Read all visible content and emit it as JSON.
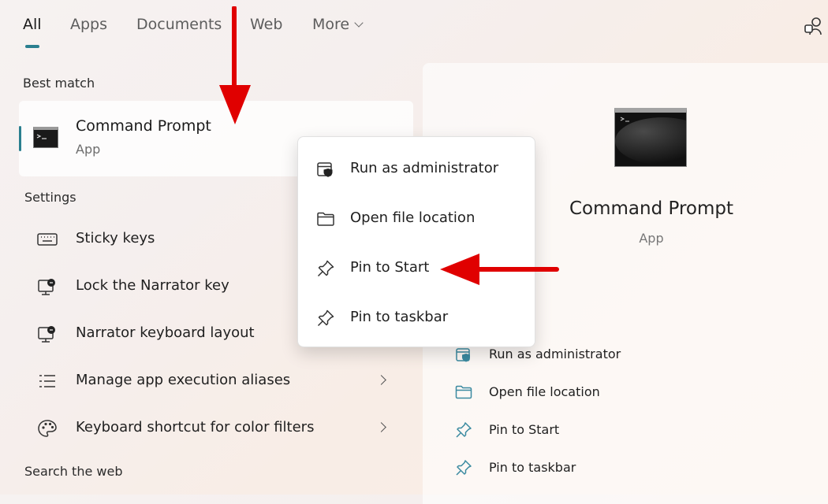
{
  "tabs": [
    {
      "label": "All",
      "active": true
    },
    {
      "label": "Apps",
      "active": false
    },
    {
      "label": "Documents",
      "active": false
    },
    {
      "label": "Web",
      "active": false
    },
    {
      "label": "More",
      "active": false
    }
  ],
  "sections": {
    "best_match": "Best match",
    "settings": "Settings",
    "search_web": "Search the web"
  },
  "best_match": {
    "title": "Command Prompt",
    "subtitle": "App"
  },
  "settings_items": [
    {
      "label": "Sticky keys",
      "icon": "keyboard-icon",
      "has_chevron": false
    },
    {
      "label": "Lock the Narrator key",
      "icon": "narrator-icon",
      "has_chevron": false
    },
    {
      "label": "Narrator keyboard layout",
      "icon": "narrator-icon",
      "has_chevron": false
    },
    {
      "label": "Manage app execution aliases",
      "icon": "list-icon",
      "has_chevron": true
    },
    {
      "label": "Keyboard shortcut for color filters",
      "icon": "palette-icon",
      "has_chevron": true
    }
  ],
  "context_menu": [
    {
      "label": "Run as administrator",
      "icon": "shield-icon"
    },
    {
      "label": "Open file location",
      "icon": "folder-icon"
    },
    {
      "label": "Pin to Start",
      "icon": "pin-icon"
    },
    {
      "label": "Pin to taskbar",
      "icon": "pin-icon"
    }
  ],
  "detail": {
    "title": "Command Prompt",
    "subtitle": "App",
    "actions": [
      {
        "label": "Run as administrator",
        "icon": "shield-icon"
      },
      {
        "label": "Open file location",
        "icon": "folder-icon"
      },
      {
        "label": "Pin to Start",
        "icon": "pin-icon"
      },
      {
        "label": "Pin to taskbar",
        "icon": "pin-icon"
      }
    ]
  },
  "colors": {
    "accent": "#2a7f8f",
    "annotation_arrow": "#e00000",
    "detail_icon_tint": "#3a8aa0"
  }
}
